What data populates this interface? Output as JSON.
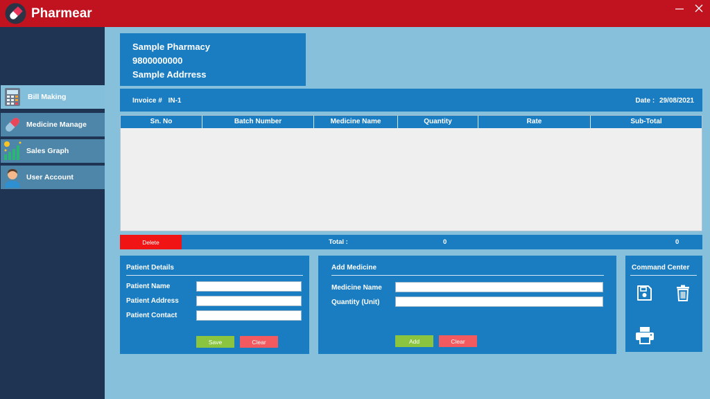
{
  "window": {
    "title": "Pharmear",
    "icons": [
      "pill-logo-icon",
      "minimize-icon",
      "close-icon"
    ]
  },
  "sidebar": {
    "items": [
      {
        "label": "Bill Making",
        "icon": "calculator-icon",
        "active": true
      },
      {
        "label": "Medicine Manage",
        "icon": "pill-icon",
        "active": false
      },
      {
        "label": "Sales Graph",
        "icon": "bar-chart-icon",
        "active": false
      },
      {
        "label": "User Account",
        "icon": "user-icon",
        "active": false
      }
    ]
  },
  "store": {
    "name": "Sample Pharmacy",
    "phone": "9800000000",
    "address": "Sample Addrress"
  },
  "invoice": {
    "label": "Invoice #",
    "number": "IN-1",
    "date_label": "Date :",
    "date": "29/08/2021"
  },
  "table": {
    "columns": [
      "Sn. No",
      "Batch Number",
      "Medicine Name",
      "Quantity",
      "Rate",
      "Sub-Total"
    ],
    "rows": []
  },
  "totals": {
    "delete_label": "Delete",
    "total_label": "Total :",
    "total_quantity": "0",
    "total_amount": "0"
  },
  "patient": {
    "title": "Patient Details",
    "name_label": "Patient Name",
    "address_label": "Patient Address",
    "contact_label": "Patient Contact",
    "name_value": "",
    "address_value": "",
    "contact_value": "",
    "save_label": "Save",
    "clear_label": "Clear"
  },
  "add_medicine": {
    "title": "Add Medicine",
    "name_label": "Medicine Name",
    "quantity_label": "Quantity (Unit)",
    "name_value": "",
    "quantity_value": "",
    "add_label": "Add",
    "clear_label": "Clear"
  },
  "command_center": {
    "title": "Command Center",
    "icons": [
      "save-icon",
      "trash-icon",
      "printer-icon"
    ]
  },
  "colors": {
    "titlebar": "#c1121f",
    "sidebar": "#1f3352",
    "panel": "#1a7dc2",
    "background": "#86c0da",
    "delete": "#f01414",
    "save_add": "#8bc53f",
    "clear": "#f25a5f"
  }
}
